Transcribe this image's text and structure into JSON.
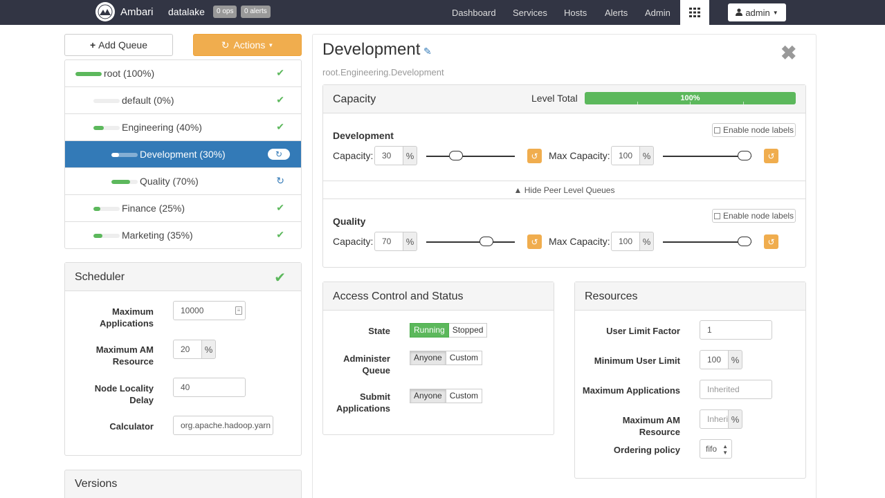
{
  "topnav": {
    "brand": "Ambari",
    "cluster": "datalake",
    "ops_badge": "0 ops",
    "alerts_badge": "0 alerts",
    "links": [
      "Dashboard",
      "Services",
      "Hosts",
      "Alerts",
      "Admin"
    ],
    "user": "admin"
  },
  "left": {
    "add_queue": "Add Queue",
    "actions": "Actions",
    "queues": [
      {
        "label": "root (100%)",
        "level": 0,
        "fill": 1.0,
        "status": "ok"
      },
      {
        "label": "default (0%)",
        "level": 1,
        "fill": 0.0,
        "status": "ok"
      },
      {
        "label": "Engineering (40%)",
        "level": 1,
        "fill": 0.4,
        "status": "ok"
      },
      {
        "label": "Development (30%)",
        "level": 2,
        "fill": 0.3,
        "status": "refresh",
        "active": true
      },
      {
        "label": "Quality (70%)",
        "level": 2,
        "fill": 0.7,
        "status": "refresh"
      },
      {
        "label": "Finance (25%)",
        "level": 1,
        "fill": 0.25,
        "status": "ok"
      },
      {
        "label": "Marketing (35%)",
        "level": 1,
        "fill": 0.35,
        "status": "ok"
      }
    ],
    "scheduler": {
      "title": "Scheduler",
      "max_apps_label": "Maximum Applications",
      "max_apps_value": "10000",
      "max_am_label": "Maximum AM Resource",
      "max_am_value": "20",
      "locality_label": "Node Locality Delay",
      "locality_value": "40",
      "calculator_label": "Calculator",
      "calculator_value": "org.apache.hadoop.yarn"
    },
    "versions_title": "Versions"
  },
  "queue": {
    "title": "Development",
    "path": "root.Engineering.Development",
    "capacity": {
      "title": "Capacity",
      "level_total_label": "Level Total",
      "level_total_value": "100%",
      "enable_node_labels": "Enable node labels",
      "capacity_label": "Capacity:",
      "max_capacity_label": "Max Capacity:",
      "hide_peer": "Hide Peer Level Queues",
      "percent": "%",
      "peers": [
        {
          "name": "Development",
          "capacity": "30",
          "max_capacity": "100"
        },
        {
          "name": "Quality",
          "capacity": "70",
          "max_capacity": "100"
        }
      ]
    },
    "access": {
      "title": "Access Control and Status",
      "state_label": "State",
      "state_on": "Running",
      "state_off": "Stopped",
      "admin_label": "Administer Queue",
      "submit_label": "Submit Applications",
      "anyone": "Anyone",
      "custom": "Custom"
    },
    "resources": {
      "title": "Resources",
      "user_limit_factor_label": "User Limit Factor",
      "user_limit_factor_value": "1",
      "min_user_limit_label": "Minimum User Limit",
      "min_user_limit_value": "100",
      "max_apps_label": "Maximum Applications",
      "max_apps_placeholder": "Inherited",
      "max_am_label": "Maximum AM Resource",
      "max_am_placeholder": "Inherited",
      "ordering_label": "Ordering policy",
      "ordering_value": "fifo"
    }
  },
  "colors": {
    "nav": "#323544",
    "primary": "#337ab7",
    "success": "#5cb85c",
    "warning": "#f0ad4e"
  }
}
